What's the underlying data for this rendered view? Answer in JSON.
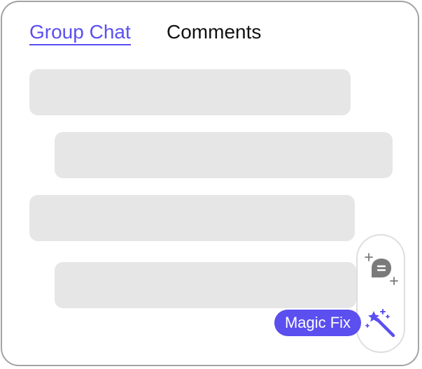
{
  "tabs": [
    {
      "label": "Group Chat",
      "active": true
    },
    {
      "label": "Comments",
      "active": false
    }
  ],
  "toolbar": {
    "buttons": [
      {
        "icon": "chat-sparkle-icon",
        "color": "#7a7a7a"
      },
      {
        "icon": "magic-wand-icon",
        "color": "#5b4ff0"
      }
    ],
    "tooltip": "Magic Fix"
  },
  "colors": {
    "accent": "#5b4ff0",
    "skeleton": "#e6e6e6",
    "border": "#a3a3a3"
  }
}
